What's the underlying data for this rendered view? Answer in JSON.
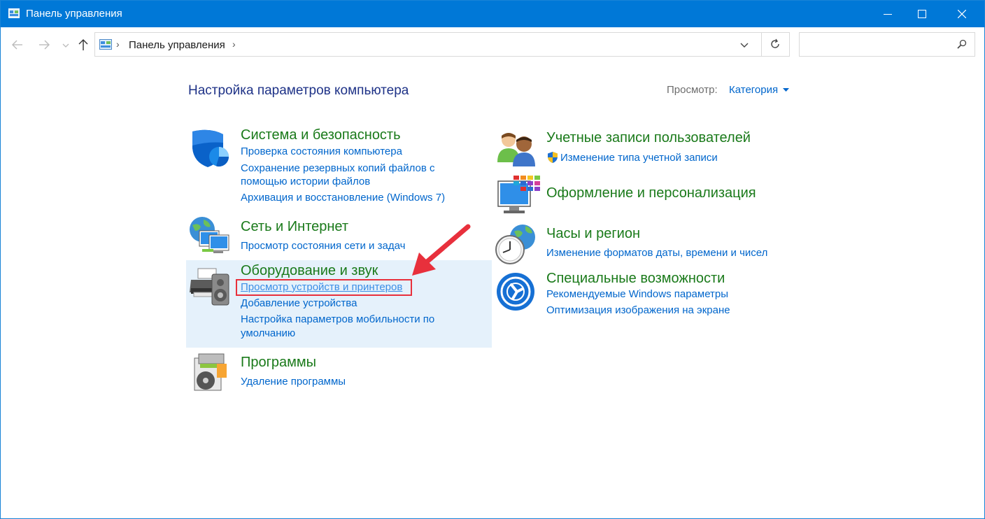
{
  "window": {
    "title": "Панель управления"
  },
  "address_bar": {
    "crumb": "Панель управления",
    "search_value": ""
  },
  "main": {
    "heading": "Настройка параметров компьютера",
    "view_label": "Просмотр:",
    "view_value": "Категория"
  },
  "categories": {
    "system": {
      "title": "Система и безопасность",
      "links": [
        "Проверка состояния компьютера",
        "Сохранение резервных копий файлов с",
        "помощью истории файлов",
        "Архивация и восстановление (Windows 7)"
      ]
    },
    "network": {
      "title": "Сеть и Интернет",
      "links": [
        "Просмотр состояния сети и задач"
      ]
    },
    "hardware": {
      "title": "Оборудование и звук",
      "links": [
        "Просмотр устройств и принтеров",
        "Добавление устройства",
        "Настройка параметров мобильности по",
        "умолчанию"
      ]
    },
    "programs": {
      "title": "Программы",
      "links": [
        "Удаление программы"
      ]
    },
    "accounts": {
      "title": "Учетные записи пользователей",
      "links": [
        "Изменение типа учетной записи"
      ]
    },
    "appearance": {
      "title": "Оформление и персонализация",
      "links": []
    },
    "clock": {
      "title": "Часы и регион",
      "links": [
        "Изменение форматов даты, времени и чисел"
      ]
    },
    "access": {
      "title": "Специальные возможности",
      "links": [
        "Рекомендуемые Windows параметры",
        "Оптимизация изображения на экране"
      ]
    }
  },
  "colors": {
    "titlebar": "#0078d7",
    "category_title": "#1a7a1a",
    "link": "#0066cc",
    "heading": "#1e3287",
    "highlight_bg": "#e5f1fb",
    "annotation": "#e8303c"
  },
  "icons": {
    "system": "shield-icon",
    "network": "network-globe-icon",
    "hardware": "printer-speaker-icon",
    "programs": "programs-disc-icon",
    "accounts": "users-icon",
    "appearance": "monitor-palette-icon",
    "clock": "clock-globe-icon",
    "access": "accessibility-icon"
  }
}
